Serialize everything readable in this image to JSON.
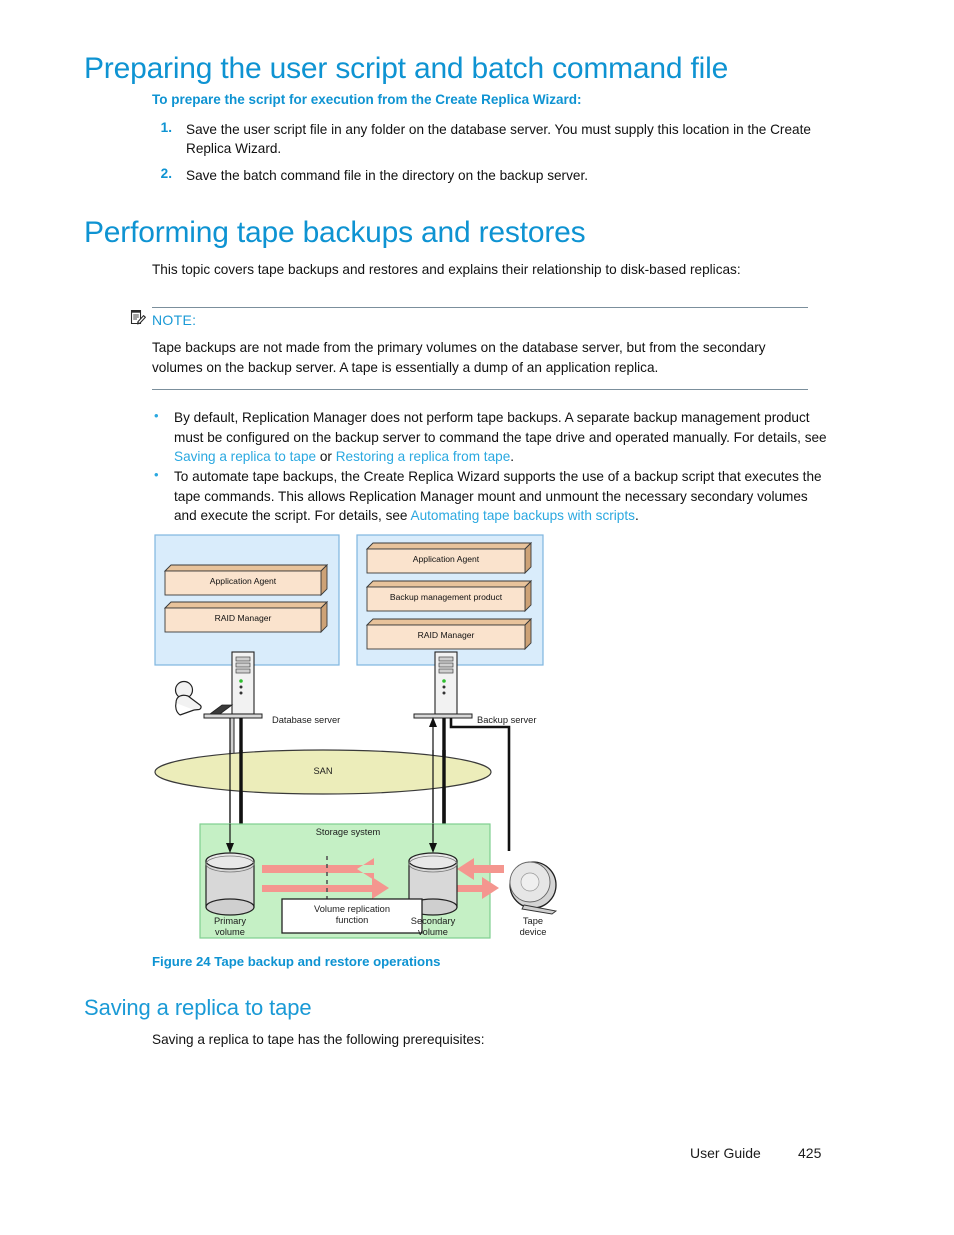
{
  "document": {
    "footer_label": "User Guide",
    "page_number": "425"
  },
  "section_one": {
    "heading": "Preparing the user script and batch command file",
    "subheading": "To prepare the script for execution from the Create Replica Wizard:",
    "steps": [
      {
        "number": "1.",
        "text": "Save the user script file in any folder on the database server. You must supply this location in the Create Replica Wizard."
      },
      {
        "number": "2.",
        "text": "Save the batch command file in the directory              on the backup server."
      }
    ]
  },
  "section_two": {
    "heading": "Performing tape backups and restores",
    "intro": "This topic covers tape backups and restores and explains their relationship to disk-based replicas:",
    "note": {
      "label": "NOTE:",
      "icon": "note-pencil-icon",
      "text": "Tape backups are not made from the primary volumes on the database server, but from the secondary volumes on the backup server. A tape is essentially a dump of an application replica."
    },
    "bullets": [
      {
        "bullet": "•",
        "part1": "By default, Replication Manager does not perform tape backups. A separate backup management product must be configured on the backup server to command the tape drive and operated manually. For details, see ",
        "link1": "Saving a replica to tape",
        "mid": " or ",
        "link2": "Restoring a replica from tape",
        "part2": "."
      },
      {
        "bullet": "•",
        "part1": "To automate tape backups, the Create Replica Wizard supports the use of a backup script that executes the tape commands. This allows Replication Manager mount and unmount the necessary secondary volumes and execute the script. For details, see ",
        "link1": "Automating tape backups with scripts",
        "part2": "."
      }
    ]
  },
  "figure": {
    "caption": "Figure 24 Tape backup and restore operations",
    "database_panel": {
      "boxes": [
        "Application Agent",
        "RAID Manager"
      ]
    },
    "backup_panel": {
      "boxes": [
        "Application Agent",
        "Backup management product",
        "RAID Manager"
      ]
    },
    "labels": {
      "database_server": "Database server",
      "backup_server": "Backup server",
      "san": "SAN",
      "storage_system": "Storage system",
      "primary_volume_line1": "Primary",
      "primary_volume_line2": "volume",
      "secondary_volume_line1": "Secondary",
      "secondary_volume_line2": "volume",
      "tape_device_line1": "Tape",
      "tape_device_line2": "device",
      "volume_replication_line1": "Volume replication",
      "volume_replication_line2": "function"
    },
    "colors": {
      "panel_fill": "#d9ecfb",
      "panel_border": "#7fb6e0",
      "box_fill": "#fae3cd",
      "box_top": "#e8c39b",
      "san_fill": "#ecedba",
      "storage_fill": "#c5f0c5",
      "storage_border": "#7fcf8f",
      "arrow_fill": "#f4968f",
      "cylinder_fill": "#d8d8d8"
    }
  },
  "section_three": {
    "heading": "Saving a replica to tape",
    "intro": "Saving a replica to tape has the following prerequisites:"
  }
}
